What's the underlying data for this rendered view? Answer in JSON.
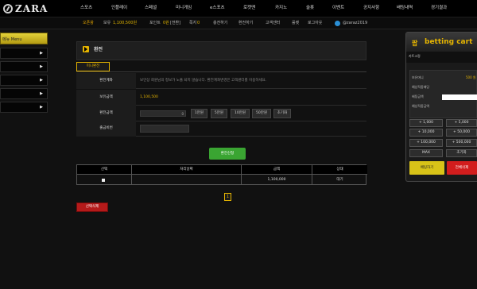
{
  "brand": {
    "name": "ZARA"
  },
  "nav": {
    "items": [
      "스포츠",
      "인플레이",
      "스페셜",
      "미니게임",
      "e스포츠",
      "로켓맨",
      "카지노",
      "슬롯",
      "이벤트",
      "공지사항",
      "배팅내역",
      "경기결과"
    ]
  },
  "subbar": {
    "logout_label": "오픈왕",
    "holding_label": "보유",
    "holding_amount": "1,100,500원",
    "point_label": "포인트",
    "point_amount": "0원",
    "convert_label": "[전환]",
    "notes_label": "쪽지",
    "notes_count": "0",
    "deposit_label": "충전하기",
    "withdraw_label": "환전하기",
    "support_label": "고객센터",
    "roulette_label": "룰렛",
    "logout_btn": "로그아웃",
    "telegram_id": "@zaraz2019"
  },
  "side_menu": {
    "header": "메뉴 Menu",
    "rows": 5,
    "arrow": "▶"
  },
  "page": {
    "title": "환전",
    "tab": "미니환전",
    "form": {
      "account_label": "환전계좌",
      "account_value": "보안상 회원님의 정보가 노출 되지 않습니다. 환전계좌변경은 고객센터를 이용하세요.",
      "balance_label": "보유금액",
      "balance_value": "1,100,500",
      "amount_label": "환전금액",
      "amount_value": "0",
      "bank_label": "출금비번"
    },
    "amount_buttons": [
      "1만원",
      "5만원",
      "10만원",
      "50만원",
      "초기화"
    ],
    "apply_label": "환전신청",
    "table": {
      "headers": [
        "선택",
        "처리날짜",
        "금액",
        "상태"
      ],
      "row": {
        "date": "",
        "amount": "1,100,000",
        "status": "대기"
      }
    },
    "pagination": [
      "1"
    ],
    "delete_selected": "선택삭제"
  },
  "cart": {
    "icon": "팝",
    "title": "betting cart",
    "top_label": "카트고정",
    "info": [
      {
        "label": "보유머니",
        "value": "500 원"
      },
      {
        "label": "예상적중배당",
        "value": ""
      },
      {
        "label": "배팅금액",
        "value": ""
      },
      {
        "label": "예상적중금액",
        "value": ""
      }
    ],
    "chips": [
      "+ 1,000",
      "+ 5,000",
      "+ 10,000",
      "+ 50,000",
      "+ 100,000",
      "+ 500,000",
      "MAX",
      "초기화"
    ],
    "bet_label": "배팅하기",
    "delete_label": "전체삭제"
  }
}
